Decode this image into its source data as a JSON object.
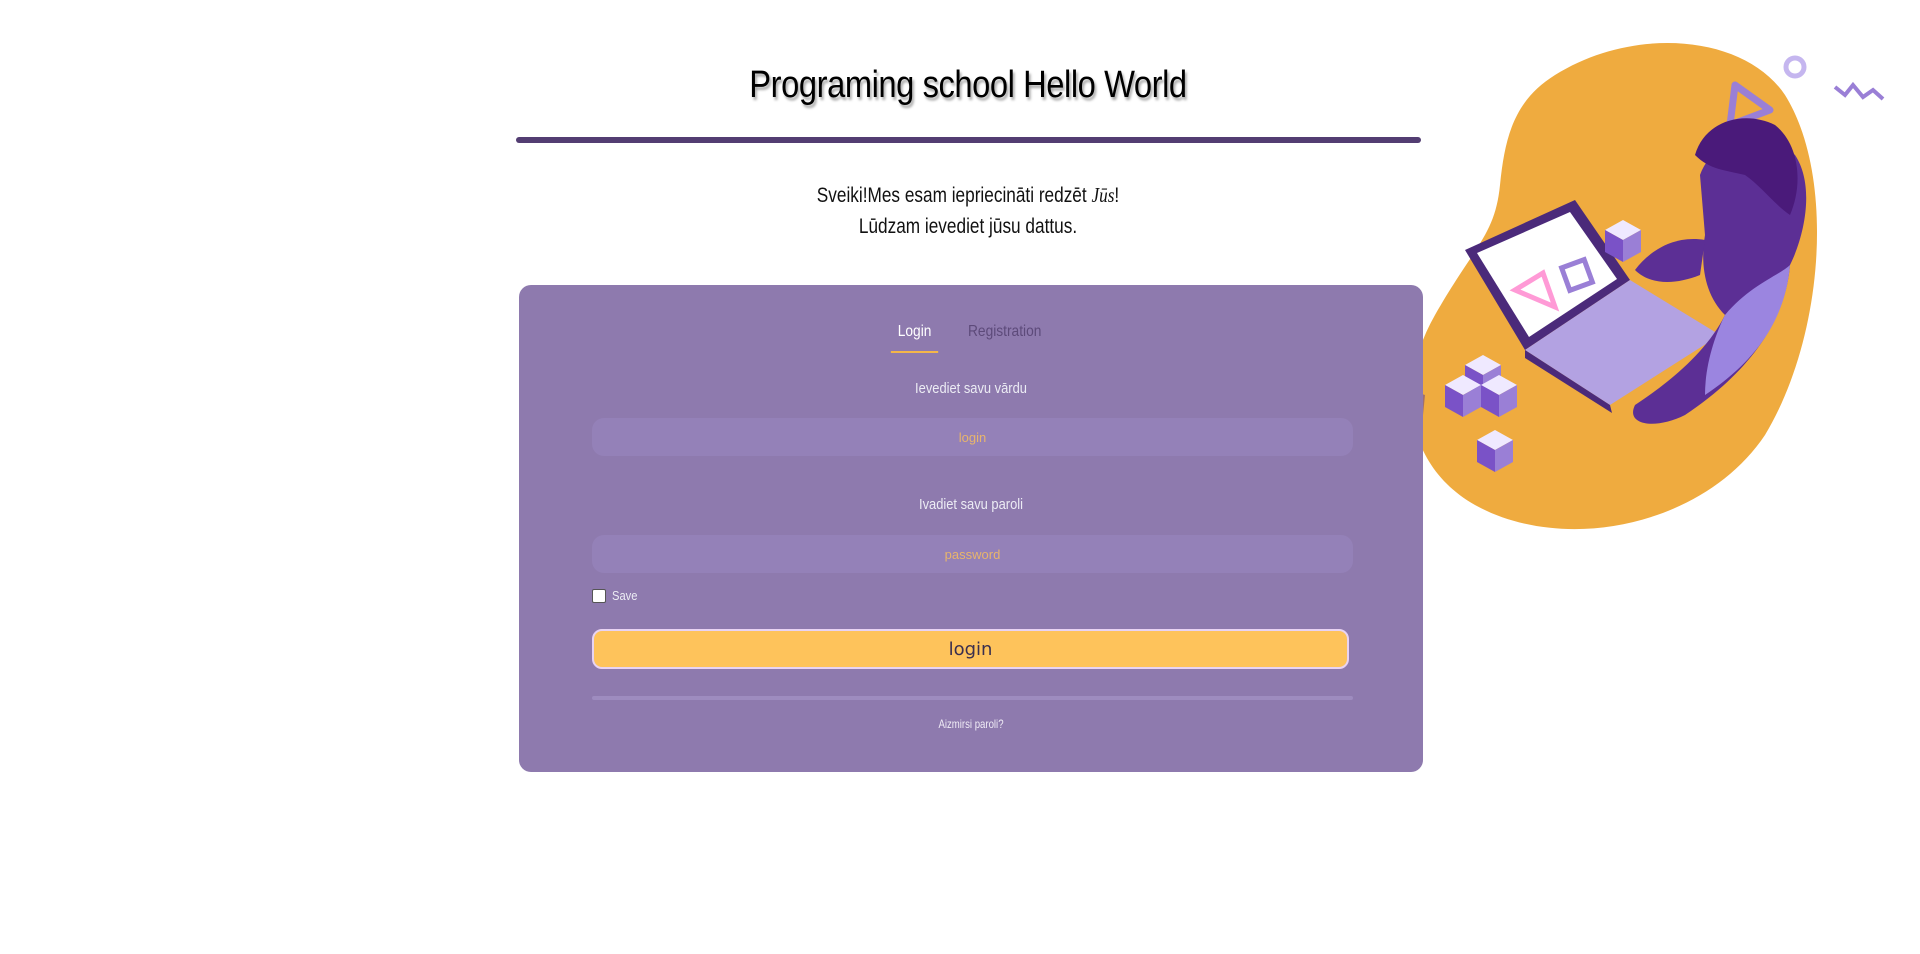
{
  "header": {
    "title": "Programing school Hello World"
  },
  "greeting": {
    "line1_start": "Sveiki!Mes esam iepriecināti redzēt ",
    "line1_emph": "Jūs",
    "line1_end": "!",
    "line2": "Lūdzam ievediet jūsu dattus."
  },
  "tabs": [
    {
      "label": "Login",
      "active": true
    },
    {
      "label": "Registration",
      "active": false
    }
  ],
  "form": {
    "username_label": "Ievediet savu vārdu",
    "username_placeholder": "login",
    "username_value": "",
    "password_label": "Ivadiet savu paroli",
    "password_placeholder": "password",
    "password_value": "",
    "save_label": "Save",
    "save_checked": false,
    "login_button": "login",
    "forgot_link": "Aizmirsi paroli?"
  },
  "colors": {
    "accent_purple": "#8e7aae",
    "title_rule": "#533d72",
    "button_yellow": "#fec35b",
    "blob_orange": "#efab3f"
  },
  "illustration": {
    "icon": "person-with-laptop-illustration"
  }
}
